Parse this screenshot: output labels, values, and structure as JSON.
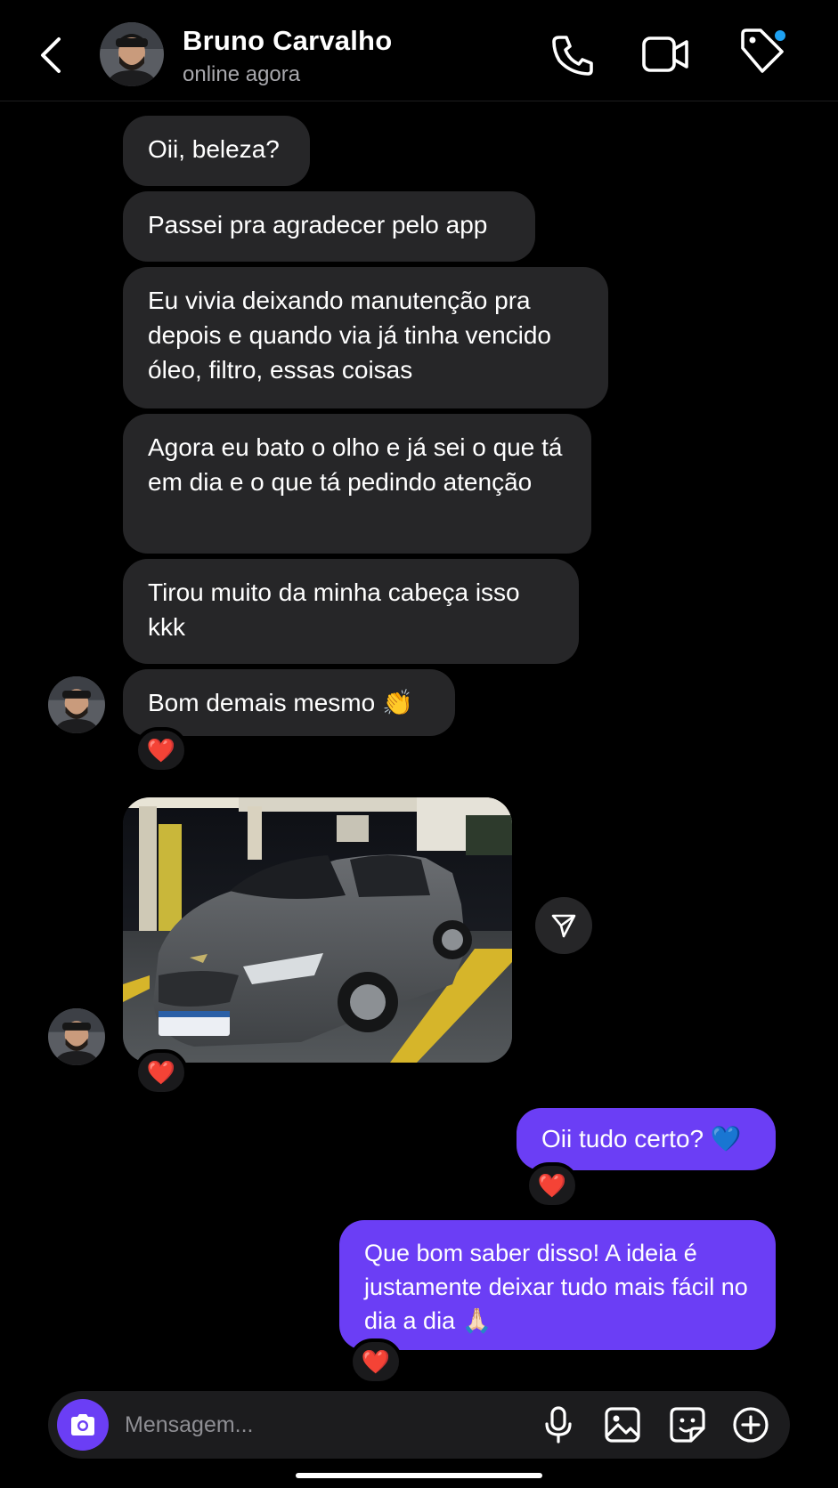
{
  "header": {
    "contact_name": "Bruno Carvalho",
    "status": "online agora",
    "icons": [
      "back-arrow-icon",
      "phone-icon",
      "video-camera-icon",
      "tag-icon"
    ],
    "notification_dot_color": "#1ea1f2"
  },
  "messages": [
    {
      "direction": "incoming",
      "text": "Oii, beleza?"
    },
    {
      "direction": "incoming",
      "text": "Passei pra agradecer pelo app"
    },
    {
      "direction": "incoming",
      "text": "Eu vivia deixando manutenção pra depois e quando via já tinha vencido óleo, filtro, essas coisas"
    },
    {
      "direction": "incoming",
      "text": "Agora eu bato o olho e já sei o que tá em dia e o que tá pedindo atenção"
    },
    {
      "direction": "incoming",
      "text": "Tirou muito da minha cabeça isso kkk"
    },
    {
      "direction": "incoming",
      "text": "Bom demais mesmo 👏",
      "reaction": "❤️"
    },
    {
      "direction": "incoming",
      "type": "photo",
      "description": "car-at-gas-station",
      "reaction": "❤️"
    },
    {
      "direction": "outgoing",
      "text": "Oii tudo certo? 💙",
      "reaction": "❤️"
    },
    {
      "direction": "outgoing",
      "text": "Que bom saber disso! A ideia é justamente deixar tudo mais fácil no dia a dia 🙏🏻",
      "reaction": "❤️"
    }
  ],
  "composer": {
    "placeholder": "Mensagem...",
    "icons": [
      "camera-icon",
      "microphone-icon",
      "image-icon",
      "sticker-icon",
      "plus-icon"
    ]
  },
  "colors": {
    "background": "#000000",
    "incoming_bubble": "#262628",
    "outgoing_bubble": "#6b3ef5",
    "accent": "#6b3ef5"
  }
}
